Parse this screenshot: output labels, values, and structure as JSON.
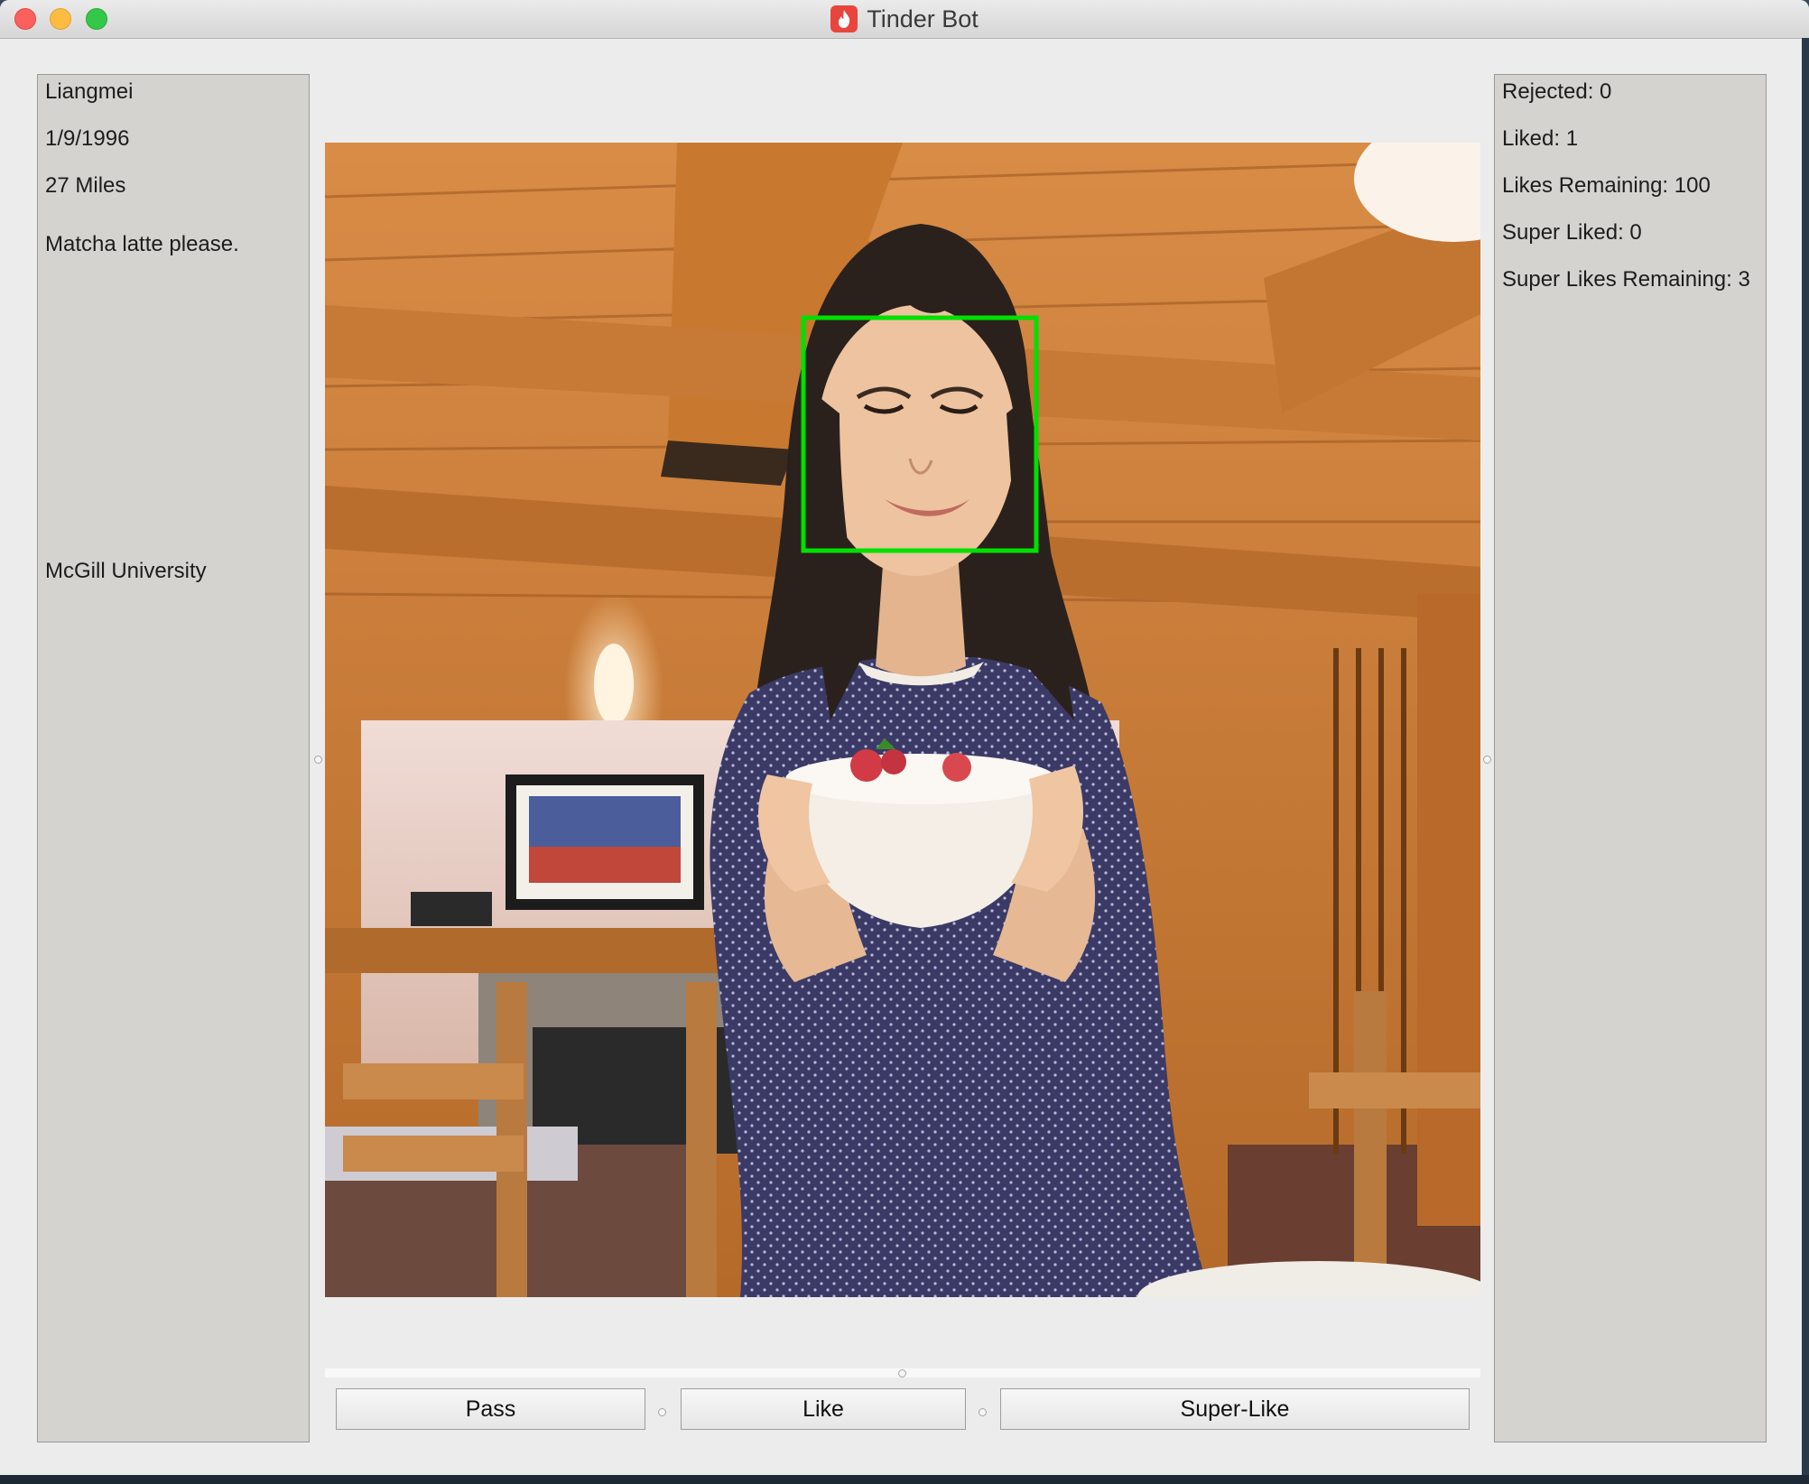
{
  "window": {
    "title": "Tinder Bot",
    "app_icon": "flame-icon"
  },
  "profile": {
    "name": "Liangmei",
    "birthdate": "1/9/1996",
    "distance": "27 Miles",
    "bio": "Matcha latte please.",
    "school": "McGill University"
  },
  "stats": {
    "rejected": "Rejected: 0",
    "liked": "Liked: 1",
    "likes_remaining": "Likes Remaining: 100",
    "super_liked": "Super Liked: 0",
    "super_likes_remaining": "Super Likes Remaining: 3"
  },
  "photo": {
    "face_box_color": "#00e000"
  },
  "buttons": {
    "pass": "Pass",
    "like": "Like",
    "super_like": "Super-Like"
  }
}
